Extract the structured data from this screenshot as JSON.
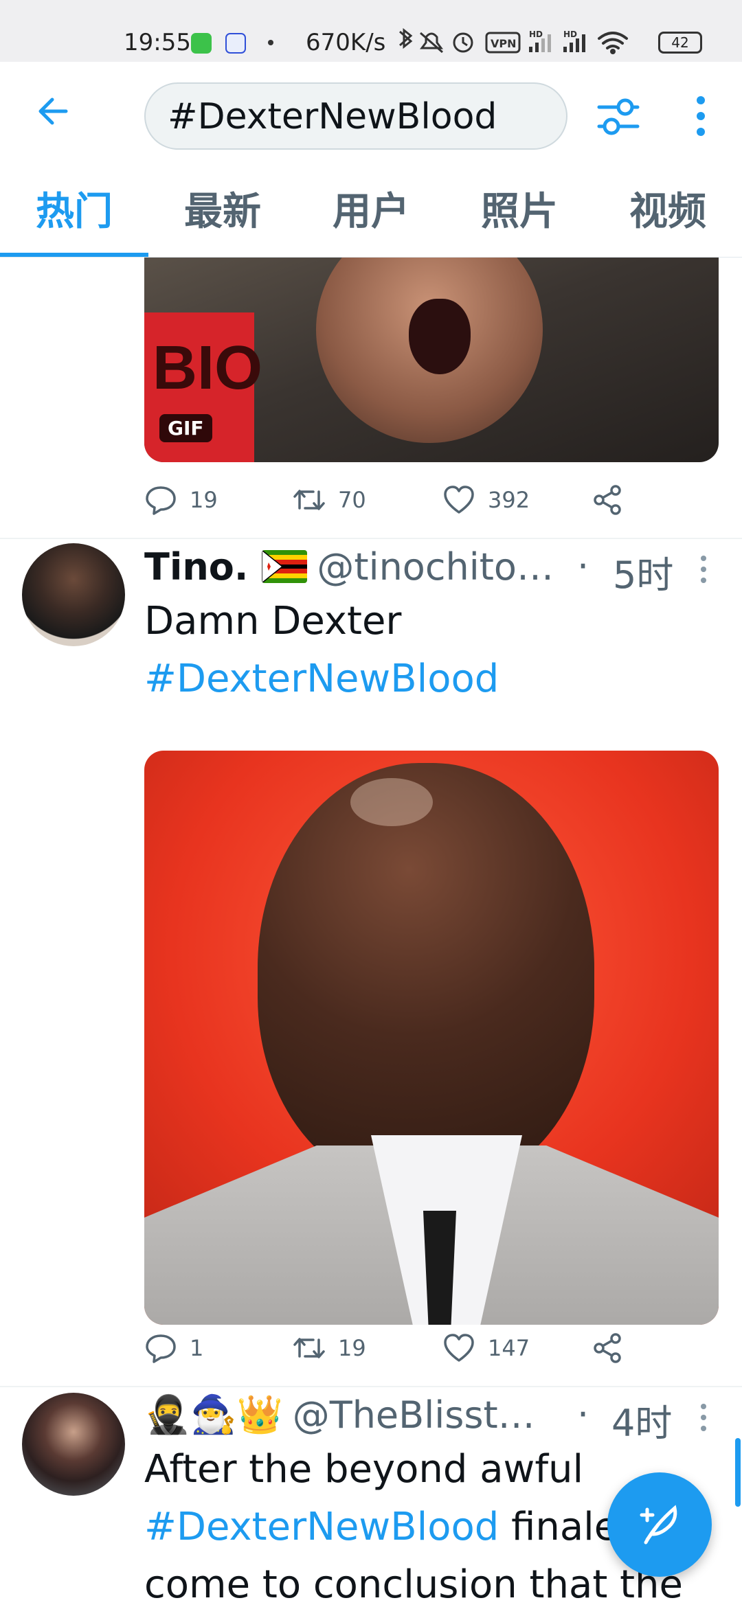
{
  "status_bar": {
    "time": "19:55",
    "network_speed": "670K/s",
    "battery": "42"
  },
  "search": {
    "query": "#DexterNewBlood"
  },
  "tabs": [
    {
      "label": "热门",
      "active": true
    },
    {
      "label": "最新",
      "active": false
    },
    {
      "label": "用户",
      "active": false
    },
    {
      "label": "照片",
      "active": false
    },
    {
      "label": "视频",
      "active": false
    }
  ],
  "tweet_prev": {
    "media_badge": "GIF",
    "media_text": "BIO",
    "replies": "19",
    "retweets": "70",
    "likes": "392"
  },
  "tweet1": {
    "name": "Tino.",
    "handle": "@tinochito…",
    "separator": "·",
    "time": "5时",
    "text": "Damn Dexter",
    "hashtag": "#DexterNewBlood",
    "replies": "1",
    "retweets": "19",
    "likes": "147"
  },
  "tweet2": {
    "name_emojis": "🥷🧙‍♂️👑",
    "handle": "@TheBlisst…",
    "separator": "·",
    "time": "4时",
    "line1": "After the beyond awful",
    "hashtag": "#DexterNewBlood",
    "line2_rest": " finale, I've",
    "line3": "come to conclusion that the"
  },
  "colors": {
    "accent": "#1d9bf0",
    "secondary_text": "#536471",
    "primary_text": "#0f1419"
  },
  "icons": {
    "back": "arrow-left-icon",
    "filter": "sliders-icon",
    "more": "more-vertical-icon",
    "reply": "comment-icon",
    "retweet": "retweet-icon",
    "like": "heart-icon",
    "share": "share-icon",
    "compose": "feather-plus-icon"
  }
}
